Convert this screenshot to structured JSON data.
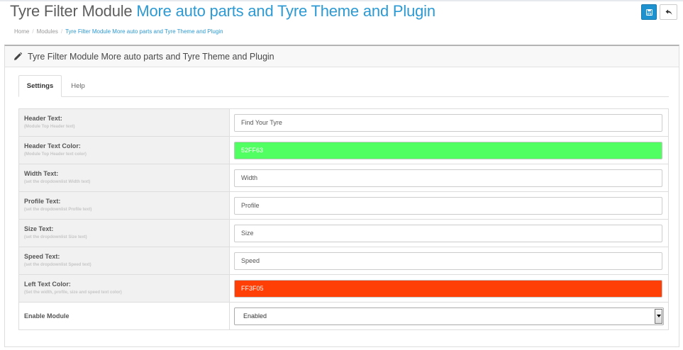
{
  "header": {
    "title_plain": "Tyre Filter Module",
    "title_link": "More auto parts and Tyre Theme and Plugin"
  },
  "breadcrumb": [
    {
      "label": "Home"
    },
    {
      "label": "Modules"
    },
    {
      "label": "Tyre Filter Module More auto parts and Tyre Theme and Plugin"
    }
  ],
  "toolbar": {
    "save_icon": "save-icon",
    "back_icon": "reply-icon"
  },
  "panel": {
    "title": "Tyre Filter Module More auto parts and Tyre Theme and Plugin",
    "icon": "pencil-icon"
  },
  "tabs": [
    {
      "label": "Settings"
    },
    {
      "label": "Help"
    }
  ],
  "fields": [
    {
      "label": "Header Text:",
      "help": "(Module Top Header text)",
      "value": "Find Your Tyre"
    },
    {
      "label": "Header Text Color:",
      "help": "(Module Top Header text color)",
      "value": "52FF63",
      "color": "#52ff63"
    },
    {
      "label": "Width Text:",
      "help": "(set the dropdownlist Width text)",
      "value": "Width"
    },
    {
      "label": "Profile Text:",
      "help": "(set the dropdownlist Profile text)",
      "value": "Profile"
    },
    {
      "label": "Size Text:",
      "help": "(set the dropdownlist Size text)",
      "value": "Size"
    },
    {
      "label": "Speed Text:",
      "help": "(set the dropdownlist Speed text)",
      "value": "Speed"
    },
    {
      "label": "Left Text Color:",
      "help": "(Set the width, profile, size and speed text color)",
      "value": "FF3F05",
      "color": "#ff3f05"
    }
  ],
  "enable_module": {
    "label": "Enable Module",
    "selected": "Enabled"
  },
  "colors": {
    "accent": "#2d9ad3",
    "primary_button": "#1e91cf"
  }
}
